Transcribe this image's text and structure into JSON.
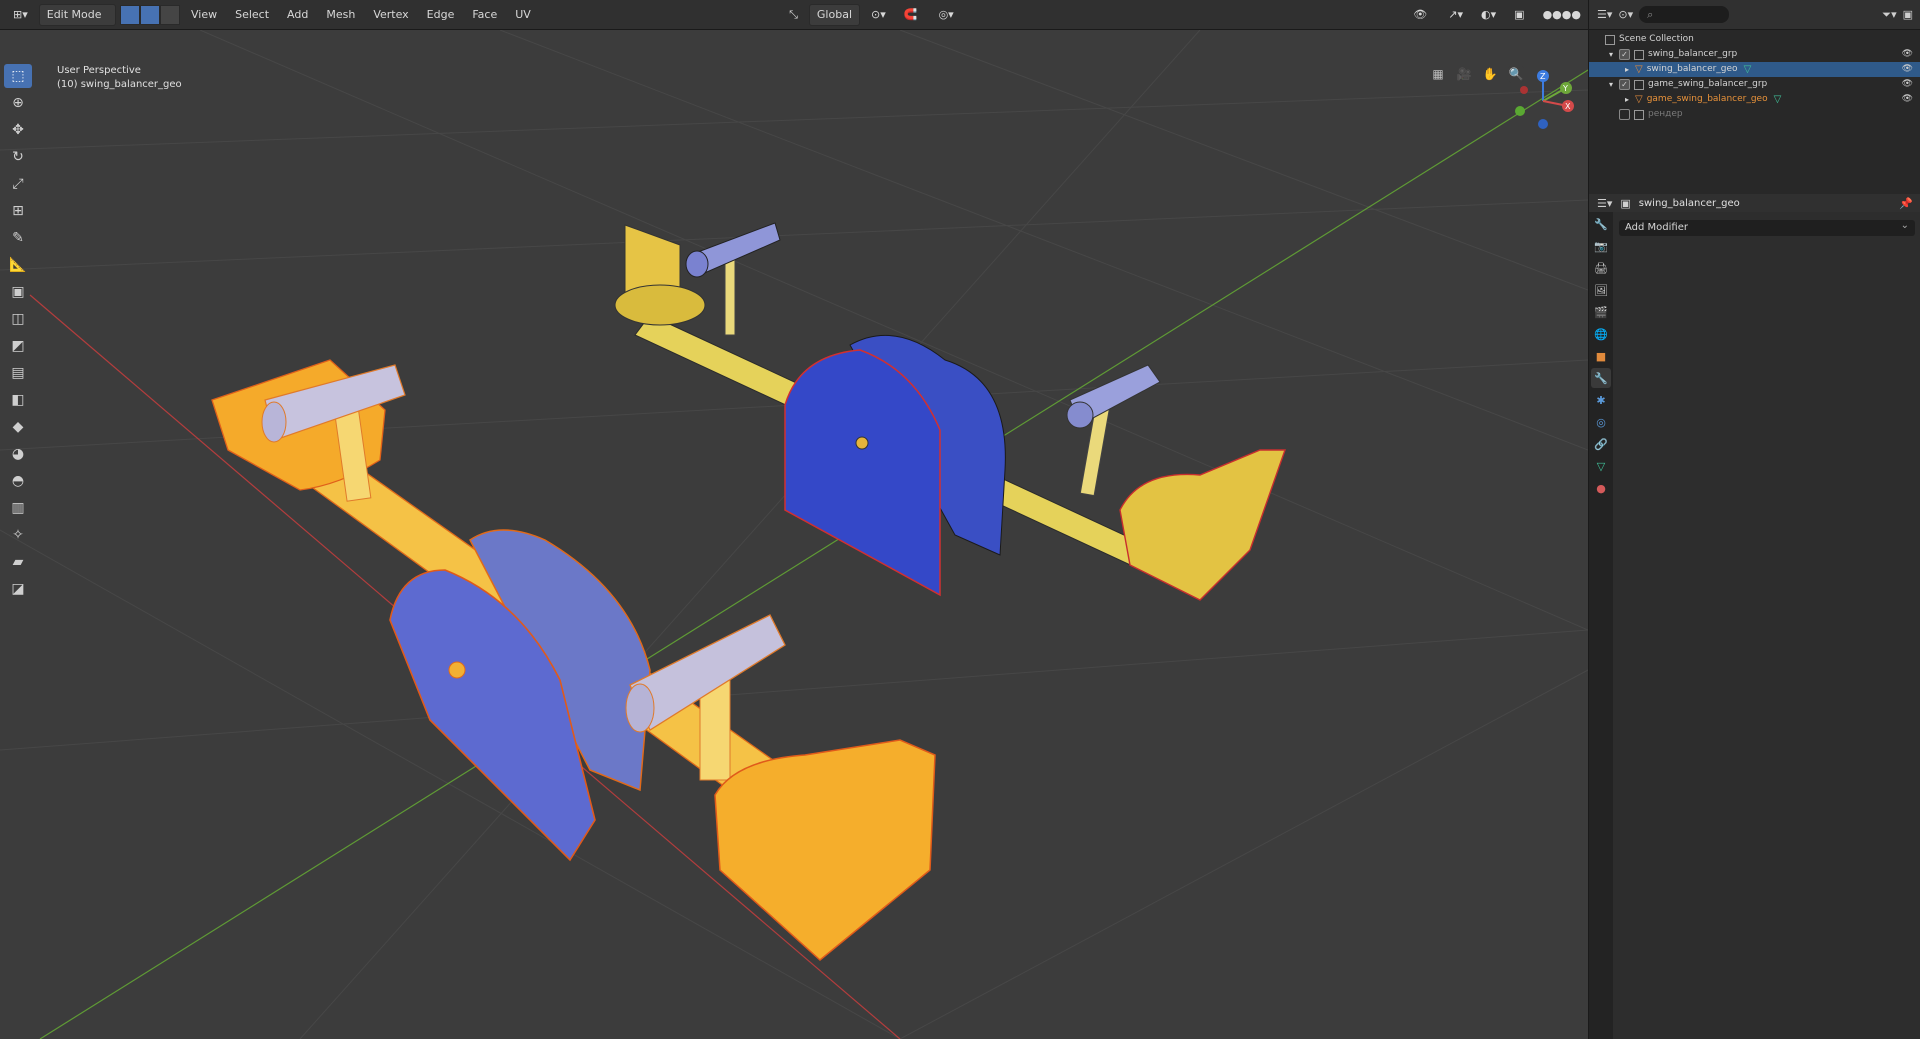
{
  "header": {
    "editor_icon": "viewport-icon",
    "mode": "Edit Mode",
    "menus": [
      "View",
      "Select",
      "Add",
      "Mesh",
      "Vertex",
      "Edge",
      "Face",
      "UV"
    ],
    "transform_orientation": "Global"
  },
  "viewport": {
    "perspective_label": "User Perspective",
    "object_label": "(10) swing_balancer_geo",
    "gizmo_axes": [
      "X",
      "Y",
      "Z"
    ],
    "colors": {
      "x_axis": "#d44a4a",
      "y_axis": "#6ea83a",
      "z_axis": "#3d7ce0"
    }
  },
  "toolbar": {
    "tools": [
      "select-box-icon",
      "cursor-icon",
      "move-icon",
      "rotate-icon",
      "scale-icon",
      "transform-icon",
      "annotate-icon",
      "measure-icon",
      "extrude-icon",
      "inset-icon",
      "bevel-icon",
      "loop-cut-icon",
      "knife-icon",
      "poly-build-icon",
      "spin-icon",
      "smooth-icon",
      "edge-slide-icon",
      "shrink-icon",
      "shear-icon",
      "rip-icon"
    ]
  },
  "outliner": {
    "search_placeholder": "",
    "items": [
      {
        "label": "Scene Collection",
        "type": "collection",
        "indent": 0,
        "selected": false,
        "checkbox": false
      },
      {
        "label": "swing_balancer_grp",
        "type": "collection",
        "indent": 1,
        "selected": false,
        "checkbox": true
      },
      {
        "label": "swing_balancer_geo",
        "type": "mesh",
        "indent": 2,
        "selected": true,
        "checkbox": false
      },
      {
        "label": "game_swing_balancer_grp",
        "type": "collection",
        "indent": 1,
        "selected": false,
        "checkbox": true
      },
      {
        "label": "game_swing_balancer_geo",
        "type": "mesh",
        "indent": 2,
        "selected": false,
        "checkbox": false
      },
      {
        "label": "рендер",
        "type": "collection",
        "indent": 1,
        "selected": false,
        "checkbox": false,
        "disabled": true
      }
    ]
  },
  "properties": {
    "object_name": "swing_balancer_geo",
    "add_modifier": "Add Modifier"
  }
}
